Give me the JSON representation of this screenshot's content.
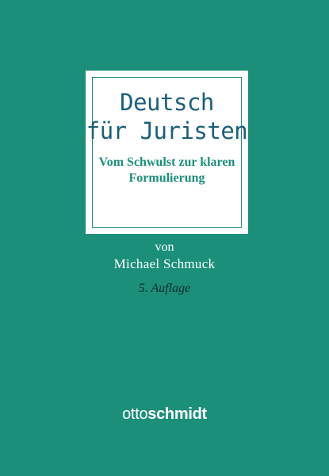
{
  "cover": {
    "background_color": "#1b8f7a",
    "title_lines": [
      "Deutsch",
      "für Juristen"
    ],
    "subtitle_lines": [
      "Vom Schwulst zur klaren",
      "Formulierung"
    ],
    "by_label": "von",
    "author": "Michael Schmuck",
    "edition": "5. Auflage",
    "publisher": {
      "part1": "otto",
      "part2": "schmidt"
    }
  }
}
